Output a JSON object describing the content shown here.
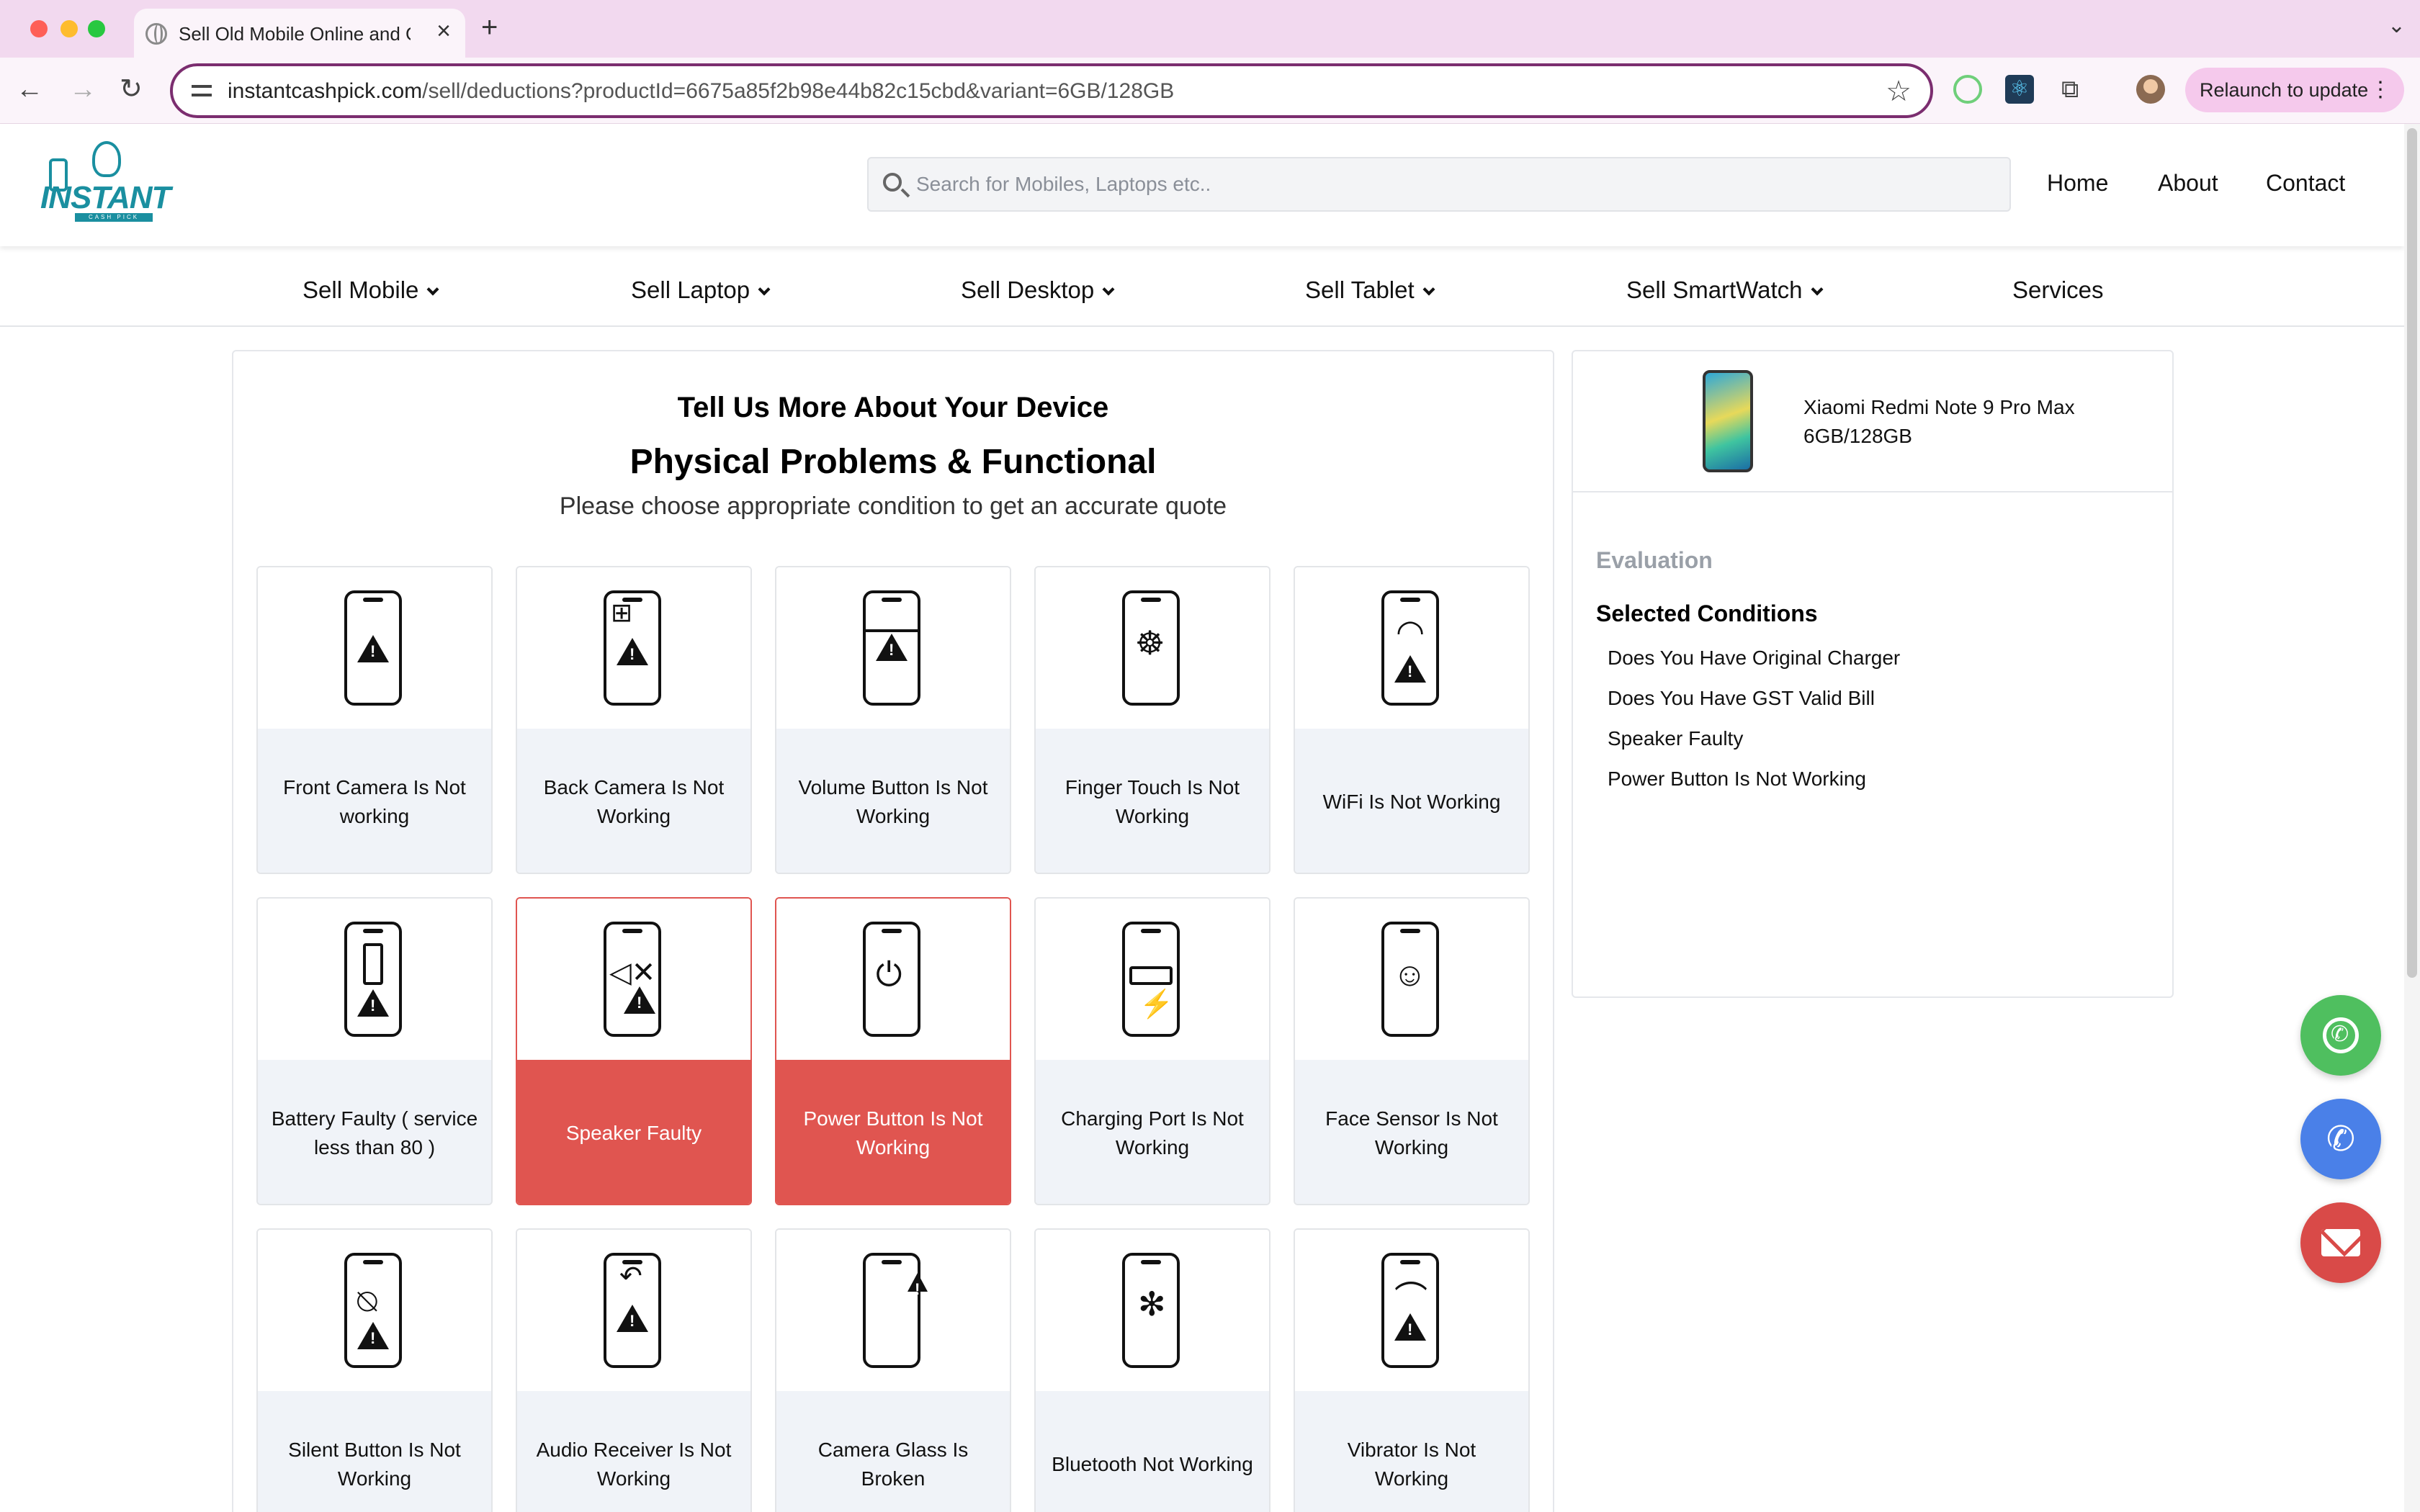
{
  "browser": {
    "tab_title": "Sell Old Mobile Online and Get Instant Cash",
    "url_domain": "instantcashpick.com",
    "url_path": "/sell/deductions?productId=6675a85f2b98e44b82c15cbd&variant=6GB/128GB",
    "relaunch_label": "Relaunch to update"
  },
  "header": {
    "logo_text": "INSTANT",
    "logo_sub": "CASH PICK",
    "search_placeholder": "Search for Mobiles, Laptops etc..",
    "links": [
      "Home",
      "About",
      "Contact"
    ]
  },
  "catnav": [
    "Sell Mobile",
    "Sell Laptop",
    "Sell Desktop",
    "Sell Tablet",
    "Sell SmartWatch",
    "Services"
  ],
  "main": {
    "heading": "Tell Us More About Your Device",
    "subheading": "Physical Problems & Functional",
    "description": "Please choose appropriate condition to get an accurate quote",
    "options": [
      {
        "label": "Front Camera Is Not working",
        "icon": "front-camera-warning-icon",
        "selected": false
      },
      {
        "label": "Back Camera Is Not Working",
        "icon": "back-camera-warning-icon",
        "selected": false
      },
      {
        "label": "Volume Button Is Not Working",
        "icon": "volume-button-warning-icon",
        "selected": false
      },
      {
        "label": "Finger Touch Is Not Working",
        "icon": "fingerprint-warning-icon",
        "selected": false
      },
      {
        "label": "WiFi Is Not Working",
        "icon": "wifi-warning-icon",
        "selected": false
      },
      {
        "label": "Battery Faulty ( service less than 80 )",
        "icon": "battery-warning-icon",
        "selected": false
      },
      {
        "label": "Speaker Faulty",
        "icon": "speaker-mute-warning-icon",
        "selected": true
      },
      {
        "label": "Power Button Is Not Working",
        "icon": "power-warning-icon",
        "selected": true
      },
      {
        "label": "Charging Port Is Not Working",
        "icon": "charging-port-warning-icon",
        "selected": false
      },
      {
        "label": "Face Sensor Is Not Working",
        "icon": "face-sensor-warning-icon",
        "selected": false
      },
      {
        "label": "Silent Button Is Not Working",
        "icon": "silent-bell-warning-icon",
        "selected": false
      },
      {
        "label": "Audio Receiver Is Not Working",
        "icon": "audio-receiver-warning-icon",
        "selected": false
      },
      {
        "label": "Camera Glass Is Broken",
        "icon": "camera-glass-warning-icon",
        "selected": false
      },
      {
        "label": "Bluetooth Not Working",
        "icon": "bluetooth-warning-icon",
        "selected": false
      },
      {
        "label": "Vibrator Is Not Working",
        "icon": "vibrator-warning-icon",
        "selected": false
      }
    ]
  },
  "summary": {
    "product_name": "Xiaomi Redmi Note 9 Pro Max 6GB/128GB",
    "evaluation_label": "Evaluation",
    "selected_title": "Selected Conditions",
    "conditions": [
      "Does You Have Original Charger",
      "Does You Have GST Valid Bill",
      "Speaker Faulty",
      "Power Button Is Not Working"
    ]
  },
  "colors": {
    "selected": "#e05550",
    "card_label_bg": "#f0f3f8",
    "whatsapp": "#4fbf5f",
    "call": "#4a80e8",
    "mail": "#d94a48",
    "brand": "#1a8fa0"
  }
}
